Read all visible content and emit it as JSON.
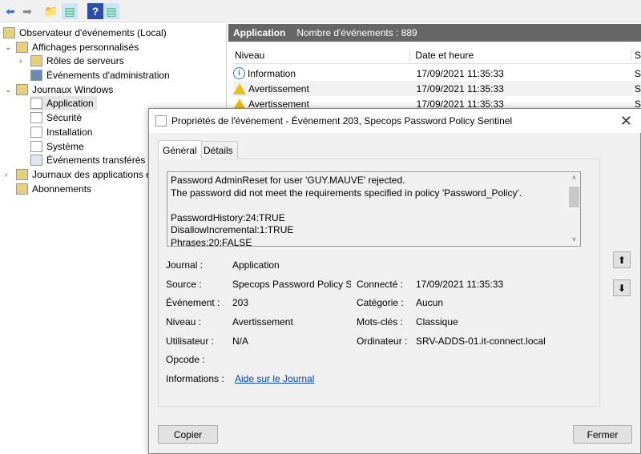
{
  "toolbar": {
    "icons": [
      "back-arrow-icon",
      "forward-arrow-icon",
      "up-folder-icon",
      "show-hide-tree-icon",
      "help-icon",
      "show-hide-action-icon"
    ]
  },
  "tree": {
    "root": "Observateur d'événements (Local)",
    "custom_views": "Affichages personnalisés",
    "server_roles": "Rôles de serveurs",
    "admin_events": "Événements d'administration",
    "windows_logs": "Journaux Windows",
    "application": "Application",
    "security": "Sécurité",
    "setup": "Installation",
    "system": "Système",
    "forwarded": "Événements transférés",
    "app_logs": "Journaux des applications e",
    "subscriptions": "Abonnements"
  },
  "list": {
    "title": "Application",
    "count": "Nombre d'événements : 889",
    "columns": [
      "Niveau",
      "Date et heure",
      "S"
    ],
    "rows": [
      {
        "level": "Information",
        "date": "17/09/2021 11:35:33",
        "src": "S",
        "icon": "info"
      },
      {
        "level": "Avertissement",
        "date": "17/09/2021 11:35:33",
        "src": "S",
        "icon": "warning"
      },
      {
        "level": "Avertissement",
        "date": "17/09/2021 11:35:33",
        "src": "S",
        "icon": "warning"
      }
    ]
  },
  "dialog": {
    "title": "Propriétés de l'événement - Événement 203, Specops Password Policy Sentinel",
    "tabs": [
      "Général",
      "Détails"
    ],
    "message": [
      "Password AdminReset for user 'GUY.MAUVE' rejected.",
      "The password did not meet the requirements specified in policy 'Password_Policy'.",
      "",
      "PasswordHistory:24:TRUE",
      "DisallowIncremental:1:TRUE",
      "Phrases:20:FALSE"
    ],
    "fields": {
      "journal_label": "Journal :",
      "journal": "Application",
      "source_label": "Source :",
      "source": "Specops Password Policy Sen",
      "connected_label": "Connecté :",
      "connected": "17/09/2021 11:35:33",
      "event_label": "Événement :",
      "event": "203",
      "category_label": "Catégorie :",
      "category": "Aucun",
      "level_label": "Niveau :",
      "level": "Avertissement",
      "keywords_label": "Mots-clés :",
      "keywords": "Classique",
      "user_label": "Utilisateur :",
      "user": "N/A",
      "computer_label": "Ordinateur :",
      "computer": "SRV-ADDS-01.it-connect.local",
      "opcode_label": "Opcode :",
      "info_label": "Informations :",
      "info_link": "Aide sur le Journal"
    },
    "copy": "Copier",
    "close": "Fermer"
  }
}
